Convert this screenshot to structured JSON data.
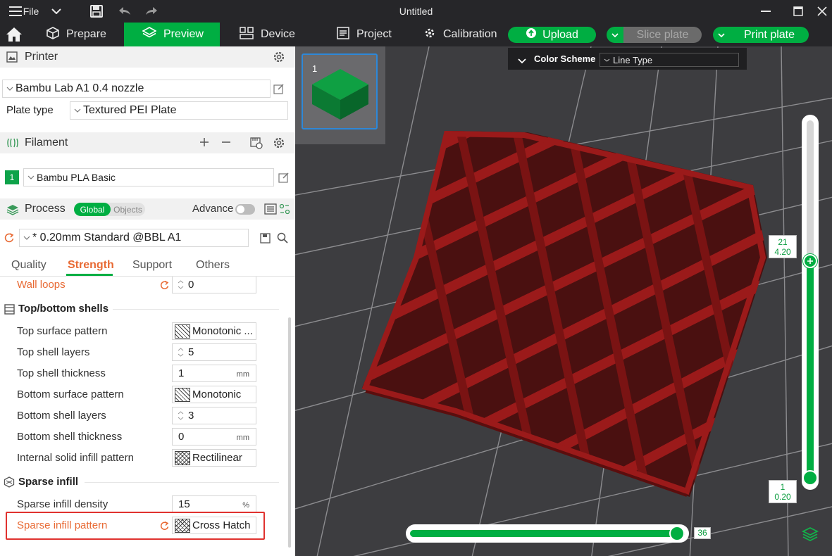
{
  "titlebar": {
    "file_label": "File",
    "window_title": "Untitled"
  },
  "toolbar": {
    "tabs": [
      {
        "label": "Prepare",
        "icon": "cube-icon"
      },
      {
        "label": "Preview",
        "icon": "layers-icon",
        "active": true
      },
      {
        "label": "Device",
        "icon": "device-icon"
      },
      {
        "label": "Project",
        "icon": "project-icon"
      },
      {
        "label": "Calibration",
        "icon": "calibration-icon"
      }
    ],
    "upload_label": "Upload",
    "slice_label": "Slice plate",
    "print_label": "Print plate",
    "accent": "#00ae42"
  },
  "printer": {
    "section_label": "Printer",
    "printer_name": "Bambu Lab A1 0.4 nozzle",
    "plate_type_label": "Plate type",
    "plate_type_value": "Textured PEI Plate"
  },
  "filament": {
    "section_label": "Filament",
    "slot_number": "1",
    "slot_color": "#0ea34a",
    "filament_name": "Bambu PLA Basic"
  },
  "process": {
    "section_label": "Process",
    "toggle_global": "Global",
    "toggle_objects": "Objects",
    "advance_label": "Advance",
    "preset": "* 0.20mm Standard @BBL A1",
    "tabs": [
      "Quality",
      "Strength",
      "Support",
      "Others"
    ],
    "active_tab": "Strength"
  },
  "settings": {
    "wall_loops": {
      "label": "Wall loops",
      "value": "0"
    },
    "top_bottom_title": "Top/bottom shells",
    "top_surface_pattern": {
      "label": "Top surface pattern",
      "value": "Monotonic ..."
    },
    "top_shell_layers": {
      "label": "Top shell layers",
      "value": "5"
    },
    "top_shell_thickness": {
      "label": "Top shell thickness",
      "value": "1",
      "unit": "mm"
    },
    "bottom_surface_pattern": {
      "label": "Bottom surface pattern",
      "value": "Monotonic"
    },
    "bottom_shell_layers": {
      "label": "Bottom shell layers",
      "value": "3"
    },
    "bottom_shell_thickness": {
      "label": "Bottom shell thickness",
      "value": "0",
      "unit": "mm"
    },
    "internal_solid_infill_pattern": {
      "label": "Internal solid infill pattern",
      "value": "Rectilinear"
    },
    "sparse_title": "Sparse infill",
    "sparse_infill_density": {
      "label": "Sparse infill density",
      "value": "15",
      "unit": "%"
    },
    "sparse_infill_pattern": {
      "label": "Sparse infill pattern",
      "value": "Cross Hatch"
    }
  },
  "viewport": {
    "plate_number": "1",
    "color_scheme_label": "Color Scheme",
    "color_scheme_value": "Line Type",
    "layer_top_number": "21",
    "layer_top_height": "4.20",
    "layer_bottom_number": "1",
    "layer_bottom_height": "0.20",
    "move_slider_value": "36",
    "vertical_slider_top_fraction": 1.0,
    "vertical_slider_range": [
      1,
      21
    ],
    "horizontal_slider_fraction": 1.0,
    "model_color": "#8b1616"
  }
}
